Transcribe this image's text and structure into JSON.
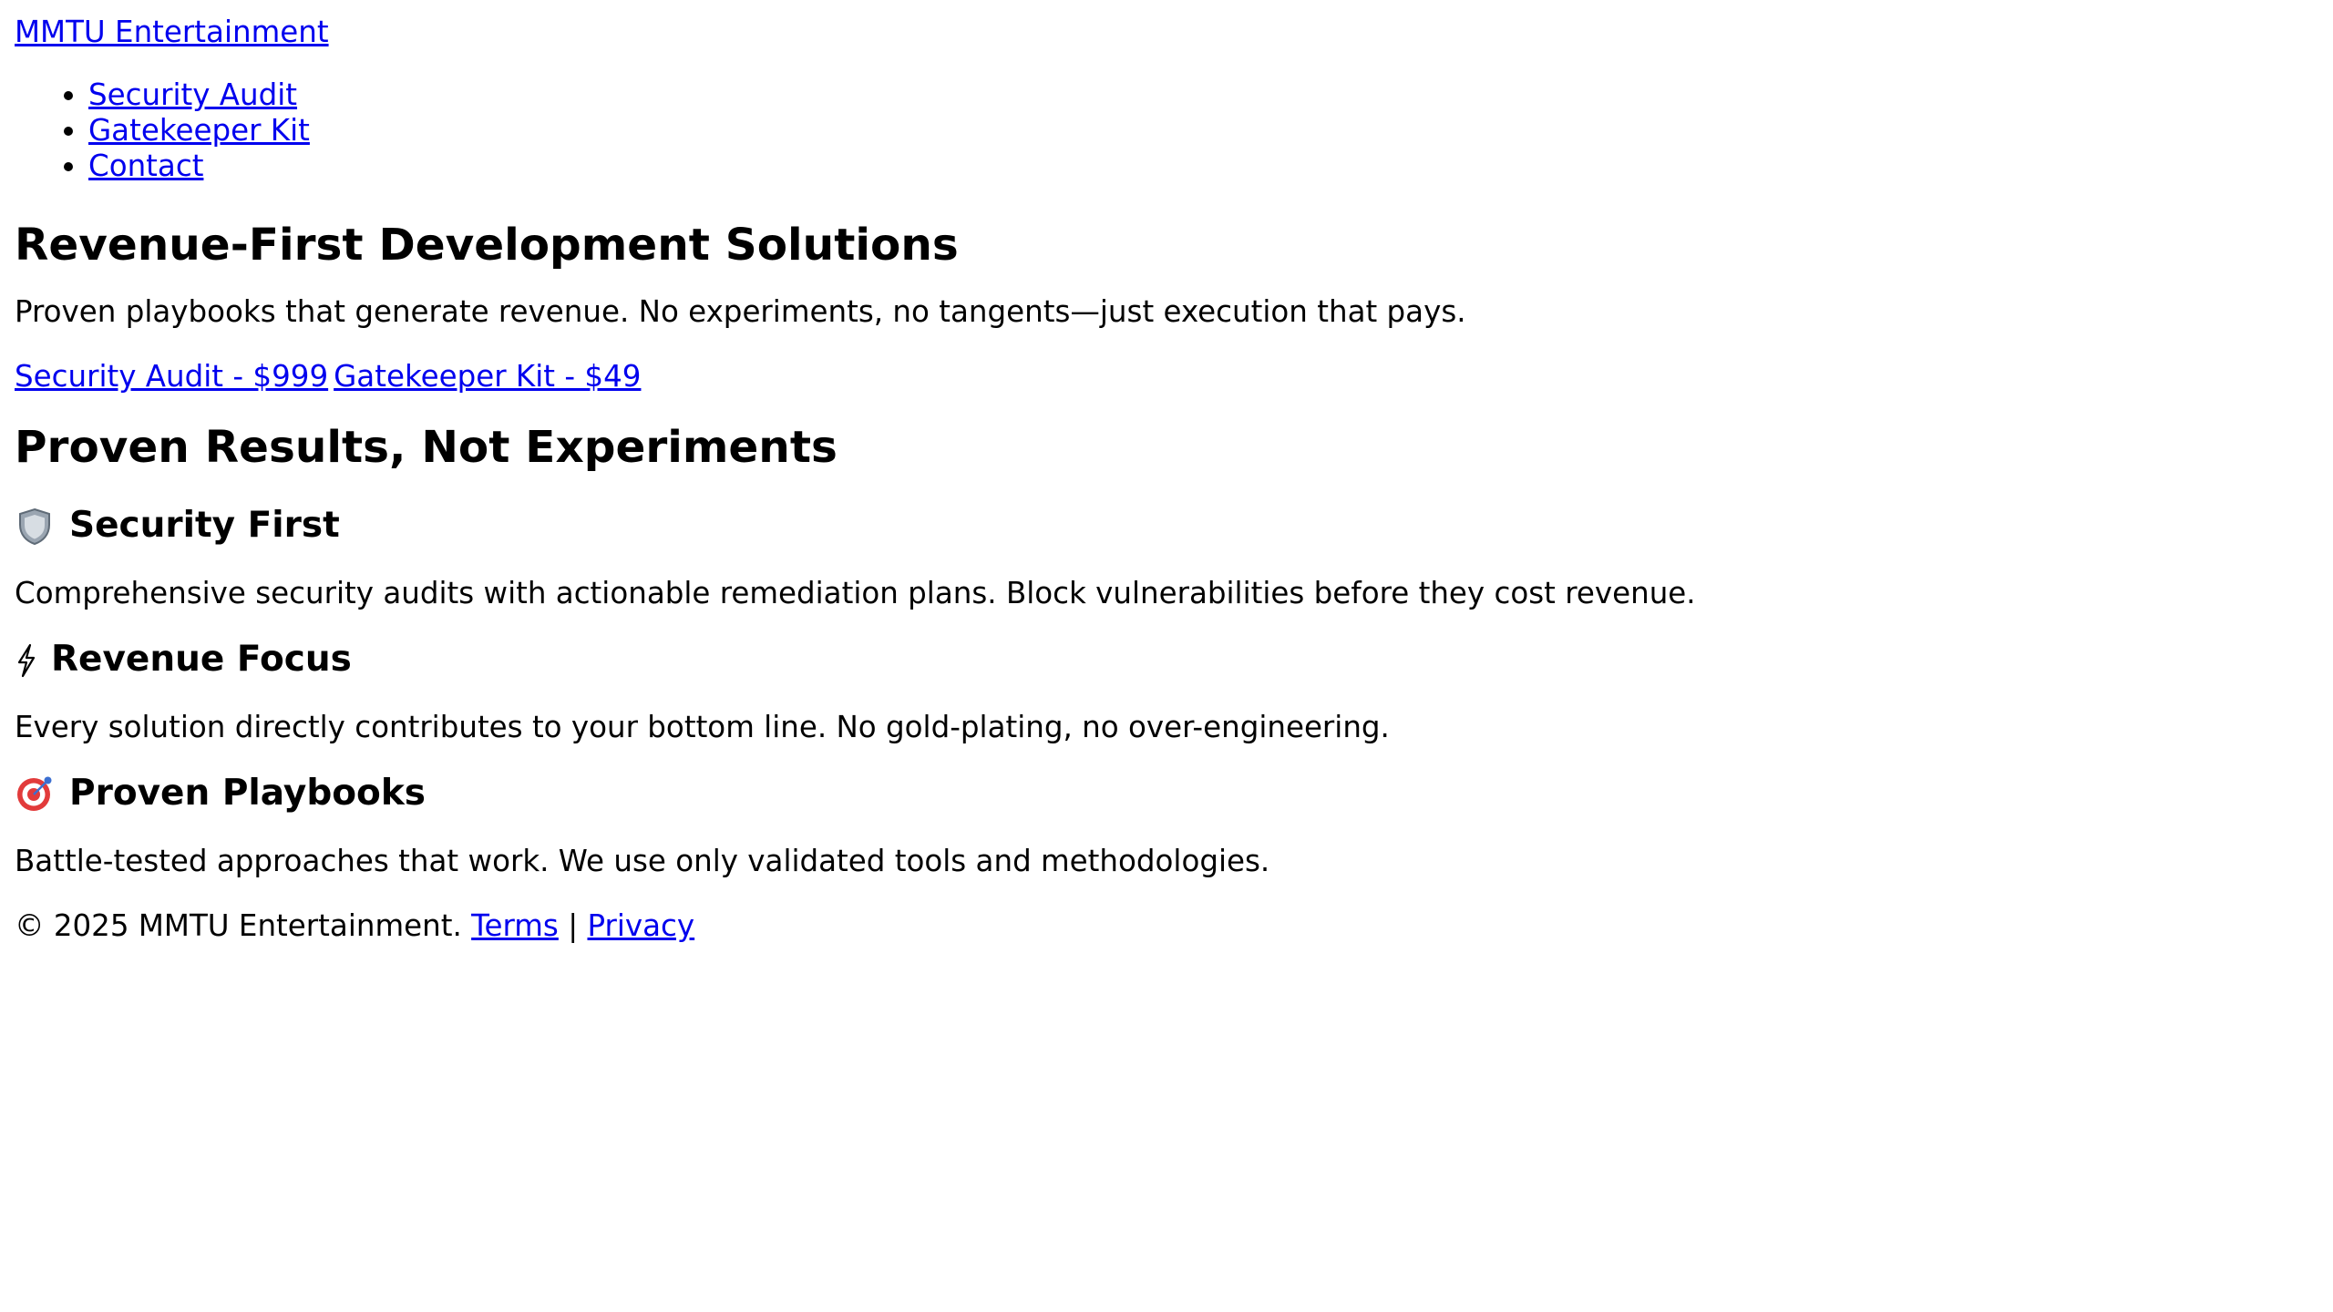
{
  "header": {
    "brand": "MMTU Entertainment"
  },
  "nav": {
    "items": [
      {
        "label": "Security Audit"
      },
      {
        "label": "Gatekeeper Kit"
      },
      {
        "label": "Contact"
      }
    ]
  },
  "hero": {
    "title": "Revenue-First Development Solutions",
    "subtitle": "Proven playbooks that generate revenue. No experiments, no tangents—just execution that pays.",
    "cta_security": "Security Audit - $999",
    "cta_gatekeeper": "Gatekeeper Kit - $49"
  },
  "features": {
    "title": "Proven Results, Not Experiments",
    "items": [
      {
        "icon": "shield-icon",
        "title": "Security First",
        "description": "Comprehensive security audits with actionable remediation plans. Block vulnerabilities before they cost revenue."
      },
      {
        "icon": "lightning-icon",
        "title": "Revenue Focus",
        "description": "Every solution directly contributes to your bottom line. No gold-plating, no over-engineering."
      },
      {
        "icon": "target-icon",
        "title": "Proven Playbooks",
        "description": "Battle-tested approaches that work. We use only validated tools and methodologies."
      }
    ]
  },
  "footer": {
    "copyright": "© 2025 MMTU Entertainment.",
    "terms": "Terms",
    "separator": "|",
    "privacy": "Privacy"
  },
  "colors": {
    "link": "#0000ee",
    "text": "#000000",
    "background": "#ffffff"
  }
}
